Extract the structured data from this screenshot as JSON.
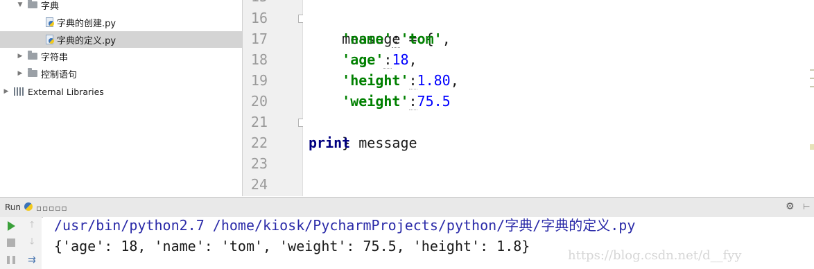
{
  "tree": {
    "items": [
      {
        "label": "字典",
        "type": "folder",
        "expanded": true,
        "level": 1
      },
      {
        "label": "字典的创建.py",
        "type": "py",
        "level": 2
      },
      {
        "label": "字典的定义.py",
        "type": "py",
        "level": 2,
        "selected": true
      },
      {
        "label": "字符串",
        "type": "folder",
        "expanded": false,
        "level": 1
      },
      {
        "label": "控制语句",
        "type": "folder",
        "expanded": false,
        "level": 1
      },
      {
        "label": "External Libraries",
        "type": "library",
        "expanded": false,
        "level": 0
      }
    ]
  },
  "editor": {
    "line_numbers": [
      "16",
      "17",
      "18",
      "19",
      "20",
      "21",
      "22",
      "23",
      "24"
    ],
    "current_line": "24",
    "code": {
      "l16": {
        "text": "message = {"
      },
      "l17": {
        "key": "'name'",
        "sep": ":",
        "val": "'tom'",
        "tail": ","
      },
      "l18": {
        "key": "'age'",
        "sep": ":",
        "val": "18",
        "tail": ","
      },
      "l19": {
        "key": "'height'",
        "sep": ":",
        "val": "1.80",
        "tail": ","
      },
      "l20": {
        "key": "'weight'",
        "sep": ":",
        "val": "75.5",
        "tail": ""
      },
      "l21": {
        "text": "}"
      },
      "l22": {
        "kw": "print",
        "rest": " message"
      }
    }
  },
  "run_panel": {
    "tab_label": "Run",
    "config_name": "▫▫▫▫▫",
    "console_lines": {
      "cmd": "/usr/bin/python2.7 /home/kiosk/PycharmProjects/python/字典/字典的定义.py",
      "output": "{'age': 18, 'name': 'tom', 'weight': 75.5, 'height': 1.8}"
    },
    "watermark": "https://blog.csdn.net/d__fyy"
  },
  "icons": {
    "gear": "gear-icon",
    "pin": "pin-icon",
    "rerun": "play-icon",
    "stop": "stop-icon",
    "pause": "pause-icon",
    "up": "arrow-up-icon",
    "down": "arrow-down-icon",
    "softwrap": "soft-wrap-icon"
  },
  "colors": {
    "keyword": "#000080",
    "string": "#008000",
    "number": "#0000ff",
    "selection": "#d4d4d4",
    "current_line": "#fefee8",
    "run_green": "#3aa03a"
  }
}
